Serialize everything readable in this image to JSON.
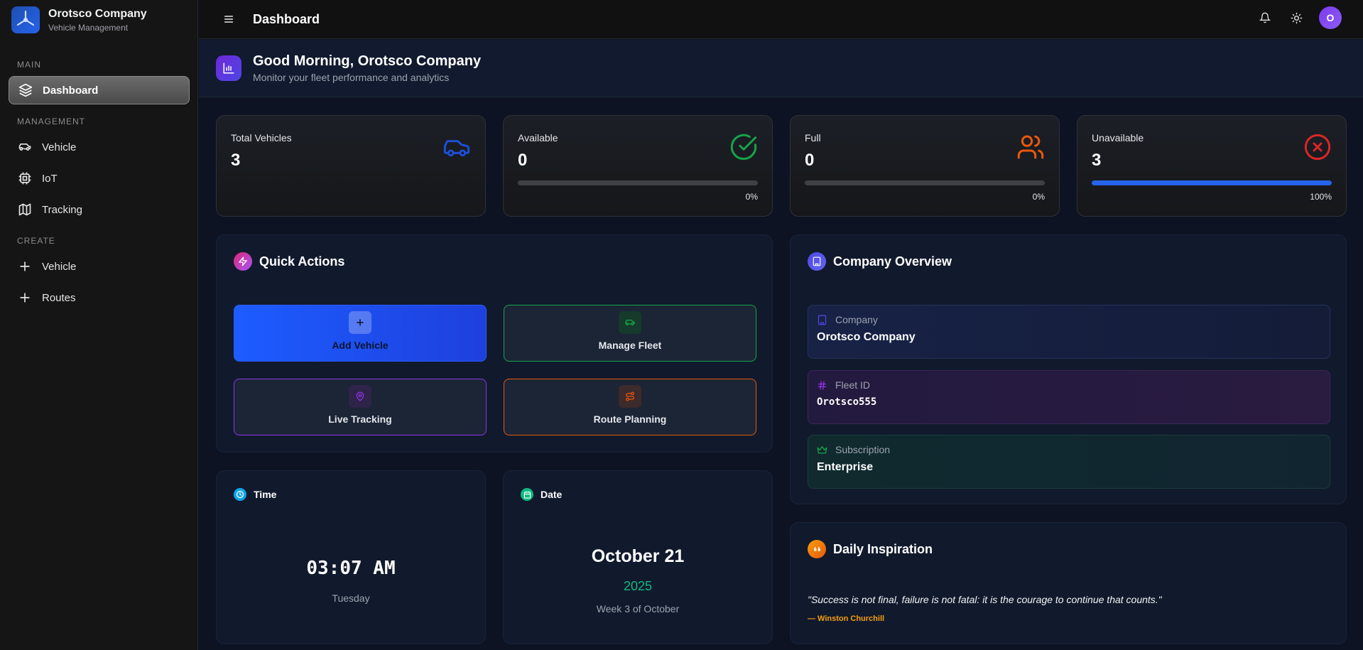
{
  "brand": {
    "title": "Orotsco Company",
    "subtitle": "Vehicle Management",
    "logo_icon": "propeller-logo-icon"
  },
  "sidebar": {
    "sections": [
      {
        "label": "MAIN"
      },
      {
        "label": "MANAGEMENT"
      },
      {
        "label": "CREATE"
      }
    ],
    "items": [
      {
        "label": "Dashboard",
        "icon": "layers-icon",
        "active": true
      },
      {
        "label": "Vehicle",
        "icon": "car-icon"
      },
      {
        "label": "IoT",
        "icon": "cpu-icon"
      },
      {
        "label": "Tracking",
        "icon": "map-icon"
      },
      {
        "label": "Vehicle",
        "icon": "plus-icon"
      },
      {
        "label": "Routes",
        "icon": "plus-icon"
      }
    ]
  },
  "topbar": {
    "title": "Dashboard",
    "avatar_initial": "O"
  },
  "greeting": {
    "title": "Good Morning, Orotsco Company",
    "subtitle": "Monitor your fleet performance and analytics"
  },
  "stats": [
    {
      "label": "Total Vehicles",
      "value": "3",
      "icon": "car-icon",
      "color": "#1d4ed8"
    },
    {
      "label": "Available",
      "value": "0",
      "percent": "0%",
      "progress": 0,
      "icon": "check-circle-icon",
      "color": "#16a34a"
    },
    {
      "label": "Full",
      "value": "0",
      "percent": "0%",
      "progress": 0,
      "icon": "users-icon",
      "color": "#ea580c"
    },
    {
      "label": "Unavailable",
      "value": "3",
      "percent": "100%",
      "progress": 1,
      "icon": "x-circle-icon",
      "color": "#dc2626"
    }
  ],
  "quick_actions": {
    "title": "Quick Actions",
    "items": [
      {
        "label": "Add Vehicle",
        "icon": "plus-icon"
      },
      {
        "label": "Manage Fleet",
        "icon": "car-icon"
      },
      {
        "label": "Live Tracking",
        "icon": "map-pin-icon"
      },
      {
        "label": "Route Planning",
        "icon": "route-icon"
      }
    ]
  },
  "company_overview": {
    "title": "Company Overview",
    "items": [
      {
        "label": "Company",
        "value": "Orotsco Company",
        "icon": "building-icon"
      },
      {
        "label": "Fleet ID",
        "value": "Orotsco555",
        "icon": "hash-icon"
      },
      {
        "label": "Subscription",
        "value": "Enterprise",
        "icon": "crown-icon"
      }
    ]
  },
  "time": {
    "title": "Time",
    "value": "03:07 AM",
    "day": "Tuesday"
  },
  "date": {
    "title": "Date",
    "value": "October 21",
    "year": "2025",
    "week": "Week 3 of October"
  },
  "inspiration": {
    "title": "Daily Inspiration",
    "quote": "\"Success is not final, failure is not fatal: it is the courage to continue that counts.\"",
    "author": "— Winston Churchill"
  }
}
